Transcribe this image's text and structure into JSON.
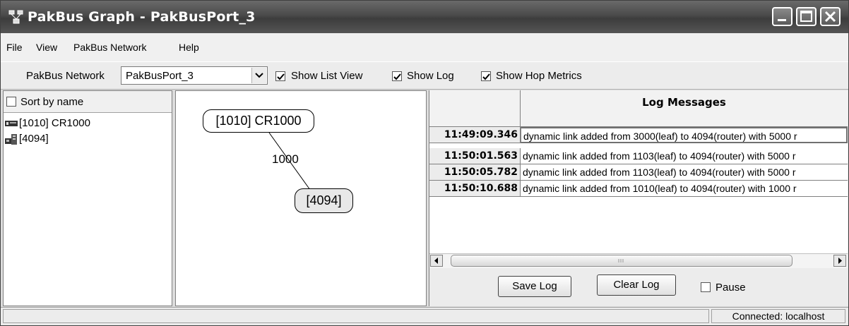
{
  "window": {
    "title": "PakBus Graph - PakBusPort_3",
    "icons": [
      "app-network-icon",
      "minimize-icon",
      "maximize-icon",
      "close-icon"
    ]
  },
  "menu": {
    "file": "File",
    "view": "View",
    "pakbus_network": "PakBus Network",
    "help": "Help"
  },
  "toolbar": {
    "network_label": "PakBus Network",
    "network_value": "PakBusPort_3",
    "show_list_view": {
      "label": "Show List View",
      "checked": true
    },
    "show_log": {
      "label": "Show Log",
      "checked": true
    },
    "show_hop_metrics": {
      "label": "Show Hop Metrics",
      "checked": true
    }
  },
  "device_list": {
    "sort_label": "Sort by name",
    "sort_checked": false,
    "items": [
      {
        "label": "[1010] CR1000",
        "icon": "datalogger-icon"
      },
      {
        "label": "[4094]",
        "icon": "router-icon"
      }
    ]
  },
  "graph": {
    "nodes": [
      {
        "label": "[1010] CR1000"
      },
      {
        "label": "[4094]"
      }
    ],
    "edge_label": "1000"
  },
  "log": {
    "header": "Log Messages",
    "rows": [
      {
        "time": "11:49:09.346",
        "message": "dynamic link added from 3000(leaf) to 4094(router) with 5000 r"
      },
      {
        "time": "11:50:01.563",
        "message": "dynamic link added from 1103(leaf) to 4094(router) with 5000 r"
      },
      {
        "time": "11:50:05.782",
        "message": "dynamic link added from 1103(leaf) to 4094(router) with 5000 r"
      },
      {
        "time": "11:50:10.688",
        "message": "dynamic link added from 1010(leaf) to 4094(router) with 1000 r"
      }
    ],
    "save_label": "Save Log",
    "clear_label": "Clear Log",
    "pause_label": "Pause",
    "pause_checked": false
  },
  "status": {
    "left": "",
    "connection": "Connected: localhost"
  }
}
